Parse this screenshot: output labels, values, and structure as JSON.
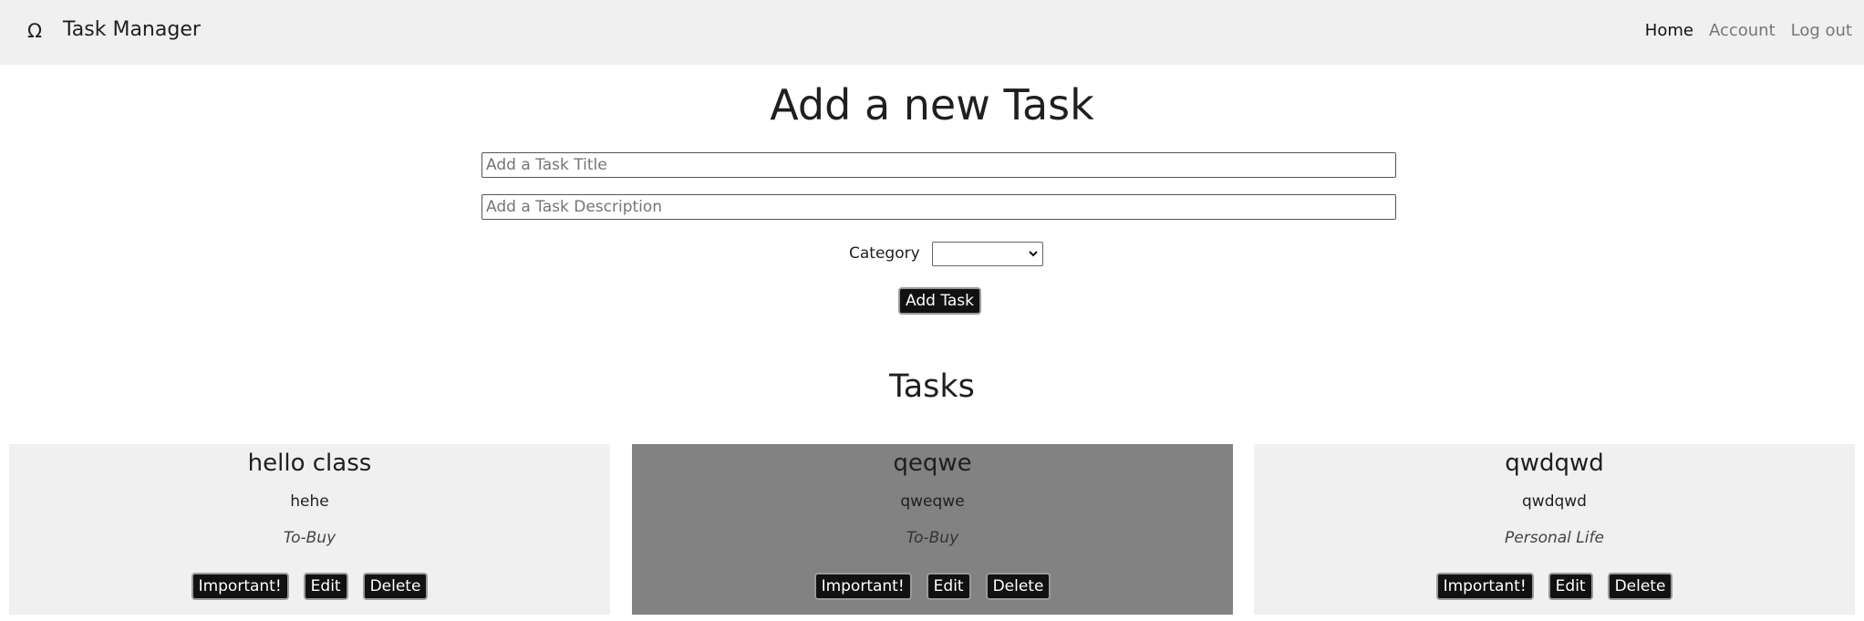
{
  "header": {
    "logo_glyph": "Ω",
    "brand": "Task Manager",
    "nav": [
      {
        "label": "Home",
        "active": true
      },
      {
        "label": "Account",
        "active": false
      },
      {
        "label": "Log out",
        "active": false
      }
    ]
  },
  "form": {
    "title": "Add a new Task",
    "title_placeholder": "Add a Task Title",
    "description_placeholder": "Add a Task Description",
    "category_label": "Category",
    "category_selected": "",
    "submit_label": "Add Task"
  },
  "tasks_section": {
    "title": "Tasks",
    "items": [
      {
        "title": "hello class",
        "description": "hehe",
        "category": "To-Buy",
        "highlighted": false,
        "buttons": {
          "important": "Important!",
          "edit": "Edit",
          "delete": "Delete"
        }
      },
      {
        "title": "qeqwe",
        "description": "qweqwe",
        "category": "To-Buy",
        "highlighted": true,
        "buttons": {
          "important": "Important!",
          "edit": "Edit",
          "delete": "Delete"
        }
      },
      {
        "title": "qwdqwd",
        "description": "qwdqwd",
        "category": "Personal Life",
        "highlighted": false,
        "buttons": {
          "important": "Important!",
          "edit": "Edit",
          "delete": "Delete"
        }
      }
    ]
  },
  "colors": {
    "navbar_bg": "#f0f0f0",
    "card_bg": "#f0f0f0",
    "card_highlight_bg": "#828282",
    "button_bg": "#111111"
  }
}
